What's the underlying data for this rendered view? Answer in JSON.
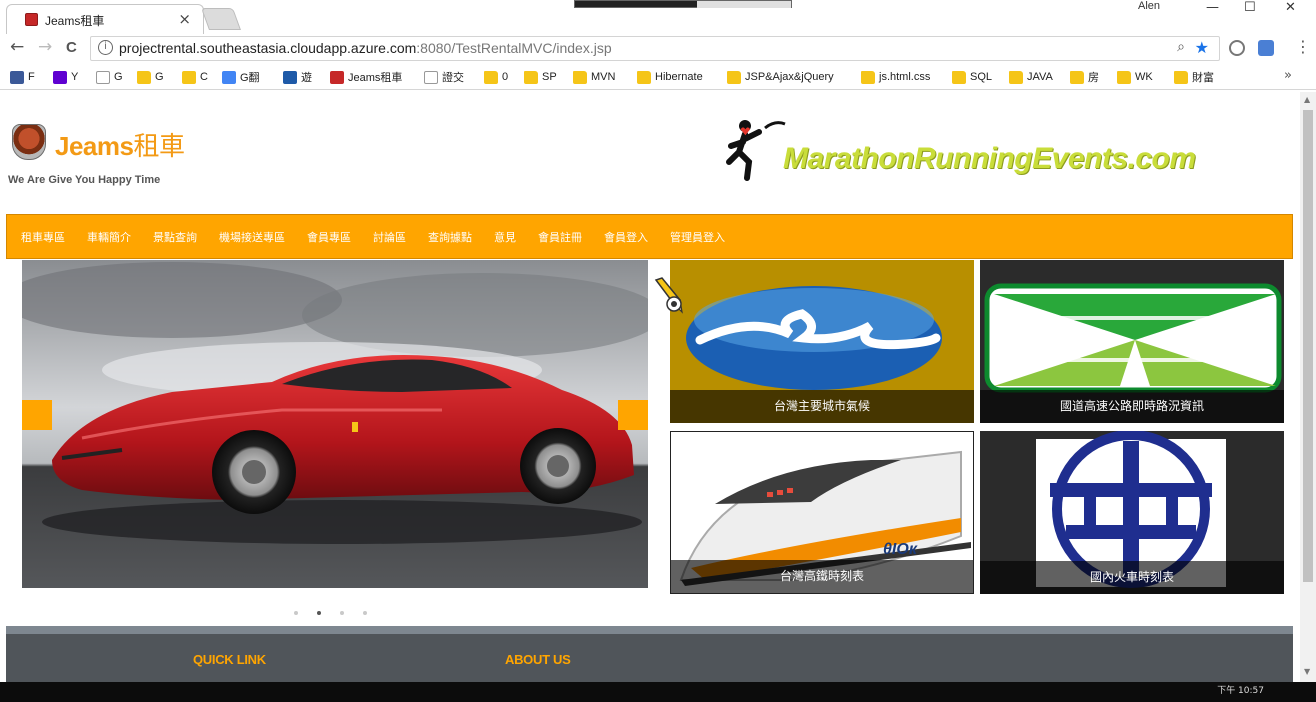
{
  "browser": {
    "tab_title": "Jeams租車",
    "tab_close": "×",
    "window_user": "Alen",
    "window_controls": [
      "—",
      "☐",
      "✕"
    ],
    "url_host": "projectrental.southeastasia.cloudapp.azure.com",
    "url_path": ":8080/TestRentalMVC/index.jsp",
    "nav": {
      "back": "←",
      "forward": "→",
      "reload": "C"
    },
    "bookmarks": [
      {
        "label": "F",
        "icon": "facebook-icon",
        "color": "#3b5998"
      },
      {
        "label": "Y",
        "icon": "yahoo-icon",
        "color": "#5f01d1"
      },
      {
        "label": "G",
        "icon": "google-icon",
        "color": "#ffffff"
      },
      {
        "label": "G",
        "icon": "folder-icon",
        "color": "#f5c518"
      },
      {
        "label": "C",
        "icon": "emoji-icon",
        "color": "#f5c518"
      },
      {
        "label": "G翻",
        "icon": "translate-icon",
        "color": "#4285f4"
      },
      {
        "label": "遊",
        "icon": "game-icon",
        "color": "#1e5aa8"
      },
      {
        "label": "Jeams租車",
        "icon": "jeams-icon",
        "color": "#c62828"
      },
      {
        "label": "證交",
        "icon": "page-icon",
        "color": "#ffffff"
      },
      {
        "label": "0",
        "icon": "folder-icon",
        "color": "#f5c518"
      },
      {
        "label": "SP",
        "icon": "folder-icon",
        "color": "#f5c518"
      },
      {
        "label": "MVN",
        "icon": "folder-icon",
        "color": "#f5c518"
      },
      {
        "label": "Hibernate",
        "icon": "folder-icon",
        "color": "#f5c518"
      },
      {
        "label": "JSP&Ajax&jQuery",
        "icon": "folder-icon",
        "color": "#f5c518"
      },
      {
        "label": "js.html.css",
        "icon": "folder-icon",
        "color": "#f5c518"
      },
      {
        "label": "SQL",
        "icon": "folder-icon",
        "color": "#f5c518"
      },
      {
        "label": "JAVA",
        "icon": "folder-icon",
        "color": "#f5c518"
      },
      {
        "label": "房",
        "icon": "folder-icon",
        "color": "#f5c518"
      },
      {
        "label": "WK",
        "icon": "folder-icon",
        "color": "#f5c518"
      },
      {
        "label": "財富",
        "icon": "folder-icon",
        "color": "#f5c518"
      }
    ],
    "bookmarks_more": "»"
  },
  "site": {
    "logo_latin": "Jeams",
    "logo_zh": "租車",
    "tagline": "We Are Give You Happy Time",
    "banner_text": "MarathonRunningEvents.com",
    "menu": [
      "租車專區",
      "車輛簡介",
      "景點查詢",
      "機場接送專區",
      "會員專區",
      "討論區",
      "查詢據點",
      "意見",
      "會員註冊",
      "會員登入",
      "管理員登入"
    ],
    "tiles": [
      {
        "caption": "台灣主要城市氣候"
      },
      {
        "caption": "國道高速公路即時路況資訊"
      },
      {
        "caption": "台灣高鐵時刻表"
      },
      {
        "caption": "國內火車時刻表"
      }
    ],
    "train_brand": "θIOк",
    "carousel_dots": 4,
    "carousel_active_dot": 2,
    "footer": {
      "quick_link": "QUICK LINK",
      "about_us": "ABOUT US"
    }
  },
  "colors": {
    "accent": "#ffa500",
    "logo": "#f39a15",
    "banner": "#c9dd3a",
    "footer": "#50555a"
  },
  "taskbar": {
    "clock": "下午 10:57"
  }
}
